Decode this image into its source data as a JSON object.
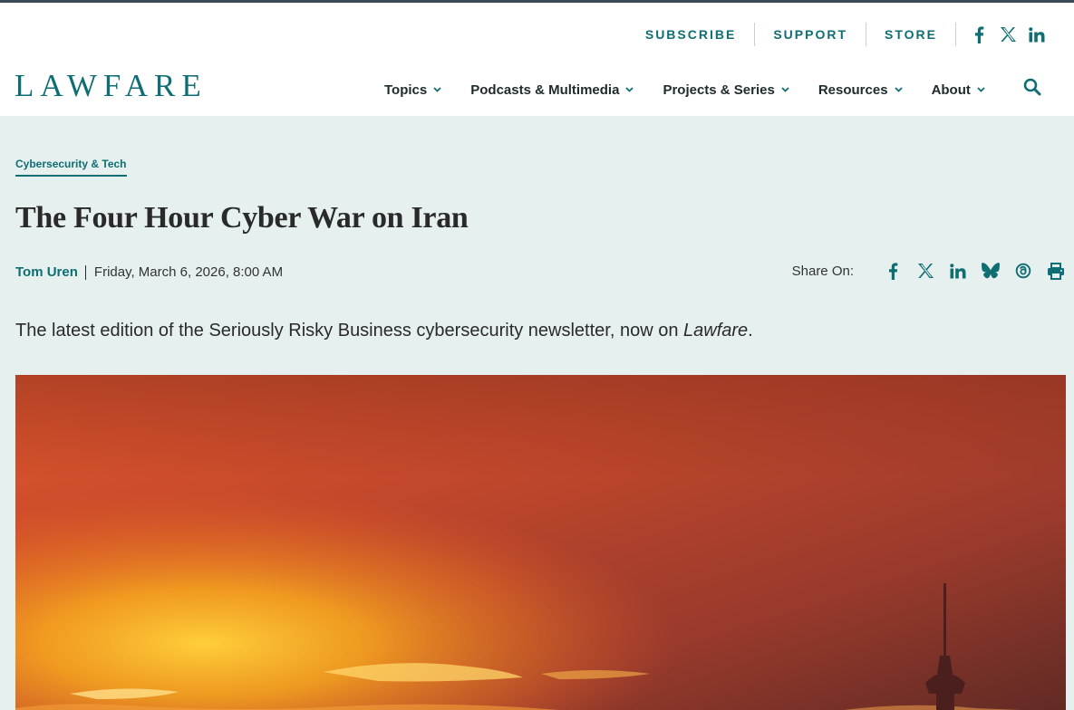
{
  "header": {
    "utility_links": [
      "SUBSCRIBE",
      "SUPPORT",
      "STORE"
    ],
    "logo": "LAWFARE",
    "nav": [
      "Topics",
      "Podcasts & Multimedia",
      "Projects & Series",
      "Resources",
      "About"
    ],
    "social_icons": [
      "facebook-icon",
      "x-icon",
      "linkedin-icon"
    ],
    "search_icon": "search-icon"
  },
  "article": {
    "category": "Cybersecurity & Tech",
    "title": "The Four Hour Cyber War on Iran",
    "author": "Tom Uren",
    "date": "Friday, March 6, 2026, 8:00 AM",
    "share_label": "Share On:",
    "share_icons": [
      "facebook-icon",
      "x-icon",
      "linkedin-icon",
      "bluesky-icon",
      "threads-icon",
      "print-icon"
    ],
    "deck_prefix": "The latest edition of the Seriously Risky Business cybersecurity newsletter, now on ",
    "deck_italic": "Lawfare",
    "deck_suffix": "."
  },
  "colors": {
    "brand": "#0e6e73",
    "page_bg": "#e6f0ef",
    "header_bg": "#ffffff",
    "text": "#1f2a2c"
  }
}
